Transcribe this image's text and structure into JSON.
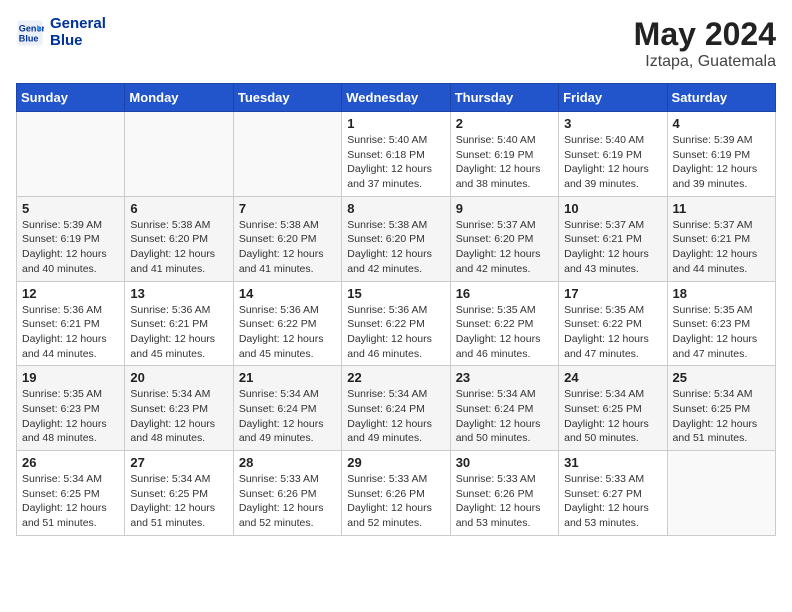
{
  "header": {
    "logo_line1": "General",
    "logo_line2": "Blue",
    "month_year": "May 2024",
    "location": "Iztapa, Guatemala"
  },
  "weekdays": [
    "Sunday",
    "Monday",
    "Tuesday",
    "Wednesday",
    "Thursday",
    "Friday",
    "Saturday"
  ],
  "weeks": [
    [
      {
        "day": "",
        "info": ""
      },
      {
        "day": "",
        "info": ""
      },
      {
        "day": "",
        "info": ""
      },
      {
        "day": "1",
        "info": "Sunrise: 5:40 AM\nSunset: 6:18 PM\nDaylight: 12 hours\nand 37 minutes."
      },
      {
        "day": "2",
        "info": "Sunrise: 5:40 AM\nSunset: 6:19 PM\nDaylight: 12 hours\nand 38 minutes."
      },
      {
        "day": "3",
        "info": "Sunrise: 5:40 AM\nSunset: 6:19 PM\nDaylight: 12 hours\nand 39 minutes."
      },
      {
        "day": "4",
        "info": "Sunrise: 5:39 AM\nSunset: 6:19 PM\nDaylight: 12 hours\nand 39 minutes."
      }
    ],
    [
      {
        "day": "5",
        "info": "Sunrise: 5:39 AM\nSunset: 6:19 PM\nDaylight: 12 hours\nand 40 minutes."
      },
      {
        "day": "6",
        "info": "Sunrise: 5:38 AM\nSunset: 6:20 PM\nDaylight: 12 hours\nand 41 minutes."
      },
      {
        "day": "7",
        "info": "Sunrise: 5:38 AM\nSunset: 6:20 PM\nDaylight: 12 hours\nand 41 minutes."
      },
      {
        "day": "8",
        "info": "Sunrise: 5:38 AM\nSunset: 6:20 PM\nDaylight: 12 hours\nand 42 minutes."
      },
      {
        "day": "9",
        "info": "Sunrise: 5:37 AM\nSunset: 6:20 PM\nDaylight: 12 hours\nand 42 minutes."
      },
      {
        "day": "10",
        "info": "Sunrise: 5:37 AM\nSunset: 6:21 PM\nDaylight: 12 hours\nand 43 minutes."
      },
      {
        "day": "11",
        "info": "Sunrise: 5:37 AM\nSunset: 6:21 PM\nDaylight: 12 hours\nand 44 minutes."
      }
    ],
    [
      {
        "day": "12",
        "info": "Sunrise: 5:36 AM\nSunset: 6:21 PM\nDaylight: 12 hours\nand 44 minutes."
      },
      {
        "day": "13",
        "info": "Sunrise: 5:36 AM\nSunset: 6:21 PM\nDaylight: 12 hours\nand 45 minutes."
      },
      {
        "day": "14",
        "info": "Sunrise: 5:36 AM\nSunset: 6:22 PM\nDaylight: 12 hours\nand 45 minutes."
      },
      {
        "day": "15",
        "info": "Sunrise: 5:36 AM\nSunset: 6:22 PM\nDaylight: 12 hours\nand 46 minutes."
      },
      {
        "day": "16",
        "info": "Sunrise: 5:35 AM\nSunset: 6:22 PM\nDaylight: 12 hours\nand 46 minutes."
      },
      {
        "day": "17",
        "info": "Sunrise: 5:35 AM\nSunset: 6:22 PM\nDaylight: 12 hours\nand 47 minutes."
      },
      {
        "day": "18",
        "info": "Sunrise: 5:35 AM\nSunset: 6:23 PM\nDaylight: 12 hours\nand 47 minutes."
      }
    ],
    [
      {
        "day": "19",
        "info": "Sunrise: 5:35 AM\nSunset: 6:23 PM\nDaylight: 12 hours\nand 48 minutes."
      },
      {
        "day": "20",
        "info": "Sunrise: 5:34 AM\nSunset: 6:23 PM\nDaylight: 12 hours\nand 48 minutes."
      },
      {
        "day": "21",
        "info": "Sunrise: 5:34 AM\nSunset: 6:24 PM\nDaylight: 12 hours\nand 49 minutes."
      },
      {
        "day": "22",
        "info": "Sunrise: 5:34 AM\nSunset: 6:24 PM\nDaylight: 12 hours\nand 49 minutes."
      },
      {
        "day": "23",
        "info": "Sunrise: 5:34 AM\nSunset: 6:24 PM\nDaylight: 12 hours\nand 50 minutes."
      },
      {
        "day": "24",
        "info": "Sunrise: 5:34 AM\nSunset: 6:25 PM\nDaylight: 12 hours\nand 50 minutes."
      },
      {
        "day": "25",
        "info": "Sunrise: 5:34 AM\nSunset: 6:25 PM\nDaylight: 12 hours\nand 51 minutes."
      }
    ],
    [
      {
        "day": "26",
        "info": "Sunrise: 5:34 AM\nSunset: 6:25 PM\nDaylight: 12 hours\nand 51 minutes."
      },
      {
        "day": "27",
        "info": "Sunrise: 5:34 AM\nSunset: 6:25 PM\nDaylight: 12 hours\nand 51 minutes."
      },
      {
        "day": "28",
        "info": "Sunrise: 5:33 AM\nSunset: 6:26 PM\nDaylight: 12 hours\nand 52 minutes."
      },
      {
        "day": "29",
        "info": "Sunrise: 5:33 AM\nSunset: 6:26 PM\nDaylight: 12 hours\nand 52 minutes."
      },
      {
        "day": "30",
        "info": "Sunrise: 5:33 AM\nSunset: 6:26 PM\nDaylight: 12 hours\nand 53 minutes."
      },
      {
        "day": "31",
        "info": "Sunrise: 5:33 AM\nSunset: 6:27 PM\nDaylight: 12 hours\nand 53 minutes."
      },
      {
        "day": "",
        "info": ""
      }
    ]
  ]
}
